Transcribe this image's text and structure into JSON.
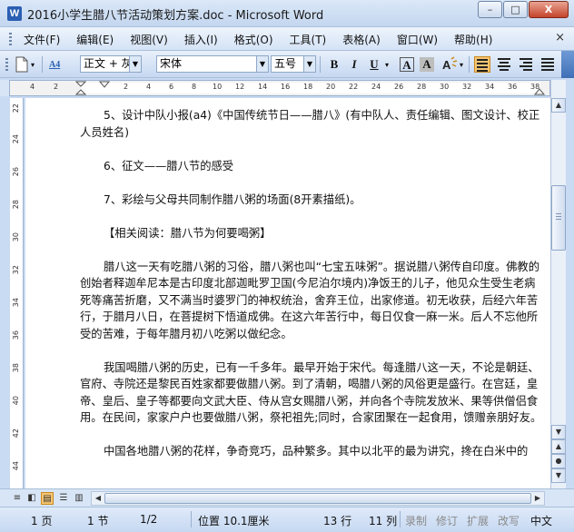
{
  "window": {
    "title": "2016小学生腊八节活动策划方案.doc - Microsoft Word",
    "app_icon": "W",
    "minimize": "–",
    "maximize": "□",
    "close": "X"
  },
  "menu": {
    "items": [
      "文件(F)",
      "编辑(E)",
      "视图(V)",
      "插入(I)",
      "格式(O)",
      "工具(T)",
      "表格(A)",
      "窗口(W)",
      "帮助(H)"
    ],
    "close_doc": "×"
  },
  "toolbar": {
    "style_icon": "A4",
    "style_value": "正文 + 灰色",
    "font_value": "宋体",
    "size_value": "五号",
    "bold": "B",
    "italic": "I",
    "underline": "U",
    "char_border": "A",
    "char_shading": "A"
  },
  "ruler": {
    "numbers": [
      "4",
      "2",
      "2",
      "4",
      "6",
      "8",
      "10",
      "12",
      "14",
      "16",
      "18",
      "20",
      "22",
      "24",
      "26",
      "28",
      "30",
      "32",
      "34",
      "36",
      "38"
    ],
    "vertical_numbers": [
      "22",
      "24",
      "26",
      "28",
      "30",
      "32",
      "34",
      "36",
      "38",
      "40",
      "42",
      "44"
    ]
  },
  "document": {
    "paragraphs": [
      "5、设计中队小报(a4)《中国传统节日——腊八》(有中队人、责任编辑、图文设计、校正人员姓名)",
      "",
      "6、征文——腊八节的感受",
      "",
      "7、彩绘与父母共同制作腊八粥的场面(8开素描纸)。",
      "",
      "【相关阅读：腊八节为何要喝粥】",
      "",
      "腊八这一天有吃腊八粥的习俗，腊八粥也叫“七宝五味粥”。据说腊八粥传自印度。佛教的创始者释迦牟尼本是古印度北部迦毗罗卫国(今尼泊尔境内)净饭王的儿子，他见众生受生老病死等痛苦折磨，又不满当时婆罗门的神权统治，舍弃王位，出家修道。初无收获，后经六年苦行，于腊月八日，在菩提树下悟道成佛。在这六年苦行中，每日仅食一麻一米。后人不忘他所受的苦难，于每年腊月初八吃粥以做纪念。",
      "",
      "我国喝腊八粥的历史，已有一千多年。最早开始于宋代。每逢腊八这一天，不论是朝廷、官府、寺院还是黎民百姓家都要做腊八粥。到了清朝，喝腊八粥的风俗更是盛行。在宫廷，皇帝、皇后、皇子等都要向文武大臣、侍从宫女赐腊八粥，并向各个寺院发放米、果等供僧侣食用。在民间，家家户户也要做腊八粥，祭祀祖先;同时，合家团聚在一起食用，馈赠亲朋好友。",
      "",
      "中国各地腊八粥的花样，争奇竞巧，品种繁多。其中以北平的最为讲究，搀在白米中的"
    ]
  },
  "status": {
    "page": "1 页",
    "section": "1 节",
    "page_of": "1/2",
    "position": "位置 10.1厘米",
    "line": "13 行",
    "column": "11 列",
    "rec": "录制",
    "trk": "修订",
    "ext": "扩展",
    "ovr": "改写",
    "lang": "中文"
  }
}
